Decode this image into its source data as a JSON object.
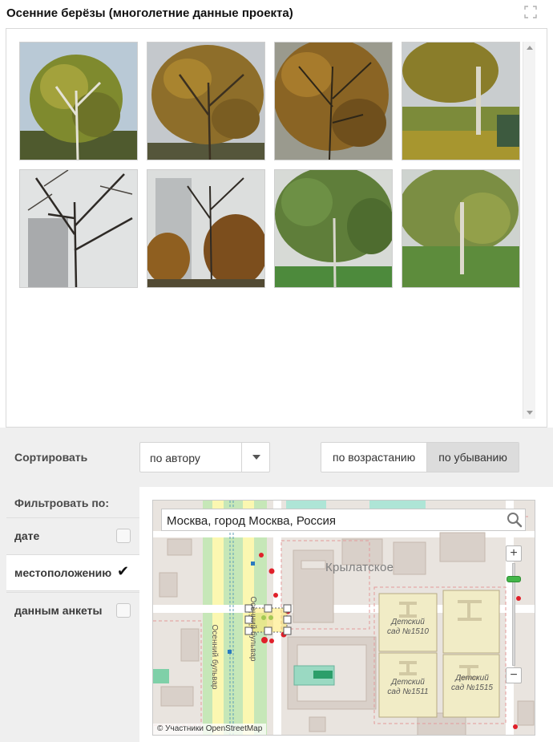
{
  "header": {
    "title": "Осенние берёзы (многолетние данные проекта)",
    "expand_icon": "expand-icon"
  },
  "gallery": {
    "photos": [
      {
        "icon": "photo-birch-1"
      },
      {
        "icon": "photo-birch-2"
      },
      {
        "icon": "photo-birch-3"
      },
      {
        "icon": "photo-birch-4"
      },
      {
        "icon": "photo-birch-5"
      },
      {
        "icon": "photo-birch-6"
      },
      {
        "icon": "photo-birch-7"
      },
      {
        "icon": "photo-birch-8"
      }
    ]
  },
  "sort": {
    "label": "Сортировать",
    "selected": "по автору",
    "order_options": [
      "по возрастанию",
      "по убыванию"
    ],
    "active_order": "по убыванию"
  },
  "filter": {
    "label": "Фильтровать по:",
    "items": [
      {
        "label": "дате",
        "checked": false
      },
      {
        "label": "местоположению",
        "checked": true
      },
      {
        "label": "данным анкеты",
        "checked": false
      }
    ],
    "checkmark": "✔"
  },
  "map": {
    "search_value": "Москва, город Москва, Россия",
    "district_label": "Крылатское",
    "street_label_1": "Осенний бульвар",
    "street_label_2": "Осенний бульвар",
    "houses": [
      {
        "line1": "Детский",
        "line2": "сад №1510"
      },
      {
        "line1": "Детский",
        "line2": "сад №1511"
      },
      {
        "line1": "Детский",
        "line2": "сад №1515"
      }
    ],
    "zoom_in": "+",
    "zoom_out": "−",
    "attribution": "© Участники OpenStreetMap"
  },
  "colors": {
    "accent_green": "#43b649",
    "marker_red": "#e0202a",
    "marker_green": "#35a33a",
    "panel_bg": "#efefef"
  }
}
